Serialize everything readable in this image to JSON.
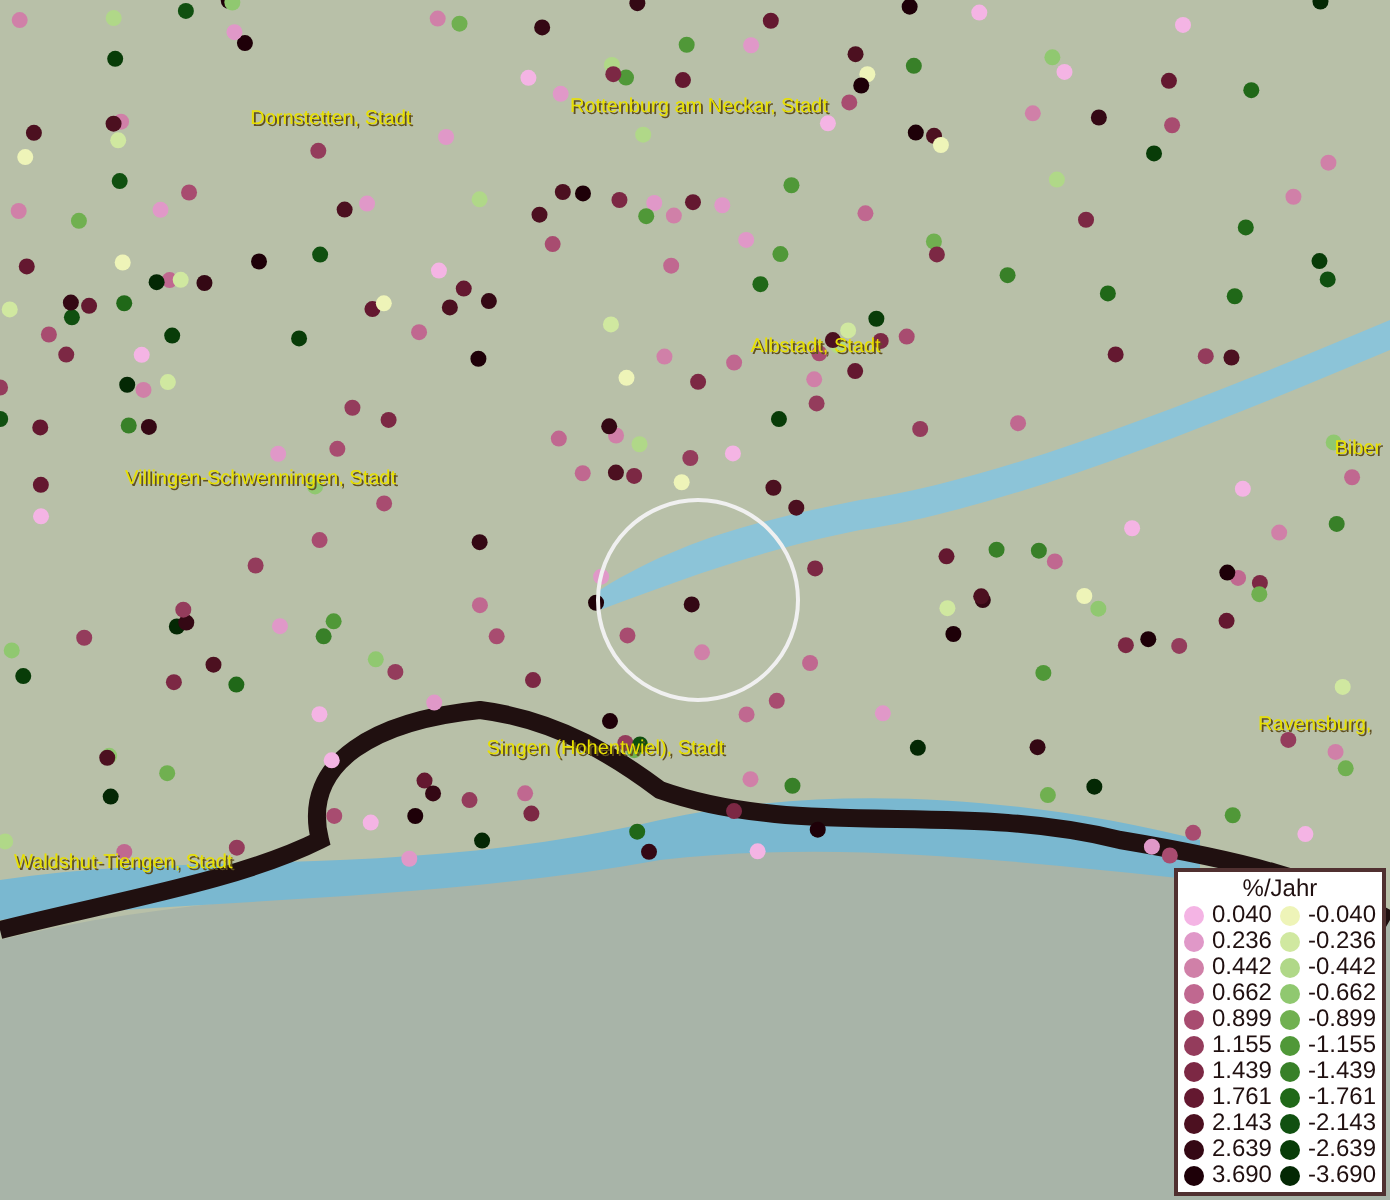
{
  "map": {
    "places": [
      {
        "name": "Dornstetten, Stadt"
      },
      {
        "name": "Rottenburg am Neckar, Stadt"
      },
      {
        "name": "Albstadt, Stadt"
      },
      {
        "name": "Villingen-Schwenningen, Stadt"
      },
      {
        "name": "Biber"
      },
      {
        "name": "Singen (Hohentwiel), Stadt"
      },
      {
        "name": "Ravensburg,"
      },
      {
        "name": "Waldshut-Tiengen, Stadt"
      }
    ]
  },
  "legend": {
    "title": "%/Jahr",
    "rows": [
      {
        "positive": {
          "value": "0.040",
          "color": "#f4b4e4"
        },
        "negative": {
          "value": "-0.040",
          "color": "#eef4b8"
        }
      },
      {
        "positive": {
          "value": "0.236",
          "color": "#e098c8"
        },
        "negative": {
          "value": "-0.236",
          "color": "#d0e8a0"
        }
      },
      {
        "positive": {
          "value": "0.442",
          "color": "#d080a8"
        },
        "negative": {
          "value": "-0.442",
          "color": "#b0d888"
        }
      },
      {
        "positive": {
          "value": "0.662",
          "color": "#c06890"
        },
        "negative": {
          "value": "-0.662",
          "color": "#90c870"
        }
      },
      {
        "positive": {
          "value": "0.899",
          "color": "#a84c70"
        },
        "negative": {
          "value": "-0.899",
          "color": "#70b050"
        }
      },
      {
        "positive": {
          "value": "1.155",
          "color": "#943c5c"
        },
        "negative": {
          "value": "-1.155",
          "color": "#509838"
        }
      },
      {
        "positive": {
          "value": "1.439",
          "color": "#7c2844"
        },
        "negative": {
          "value": "-1.439",
          "color": "#388028"
        }
      },
      {
        "positive": {
          "value": "1.761",
          "color": "#641830"
        },
        "negative": {
          "value": "-1.761",
          "color": "#206818"
        }
      },
      {
        "positive": {
          "value": "2.143",
          "color": "#4c1020"
        },
        "negative": {
          "value": "-2.143",
          "color": "#105010"
        }
      },
      {
        "positive": {
          "value": "2.639",
          "color": "#340814"
        },
        "negative": {
          "value": "-2.639",
          "color": "#083c08"
        }
      },
      {
        "positive": {
          "value": "3.690",
          "color": "#1e0008"
        },
        "negative": {
          "value": "-3.690",
          "color": "#042804"
        }
      }
    ]
  }
}
